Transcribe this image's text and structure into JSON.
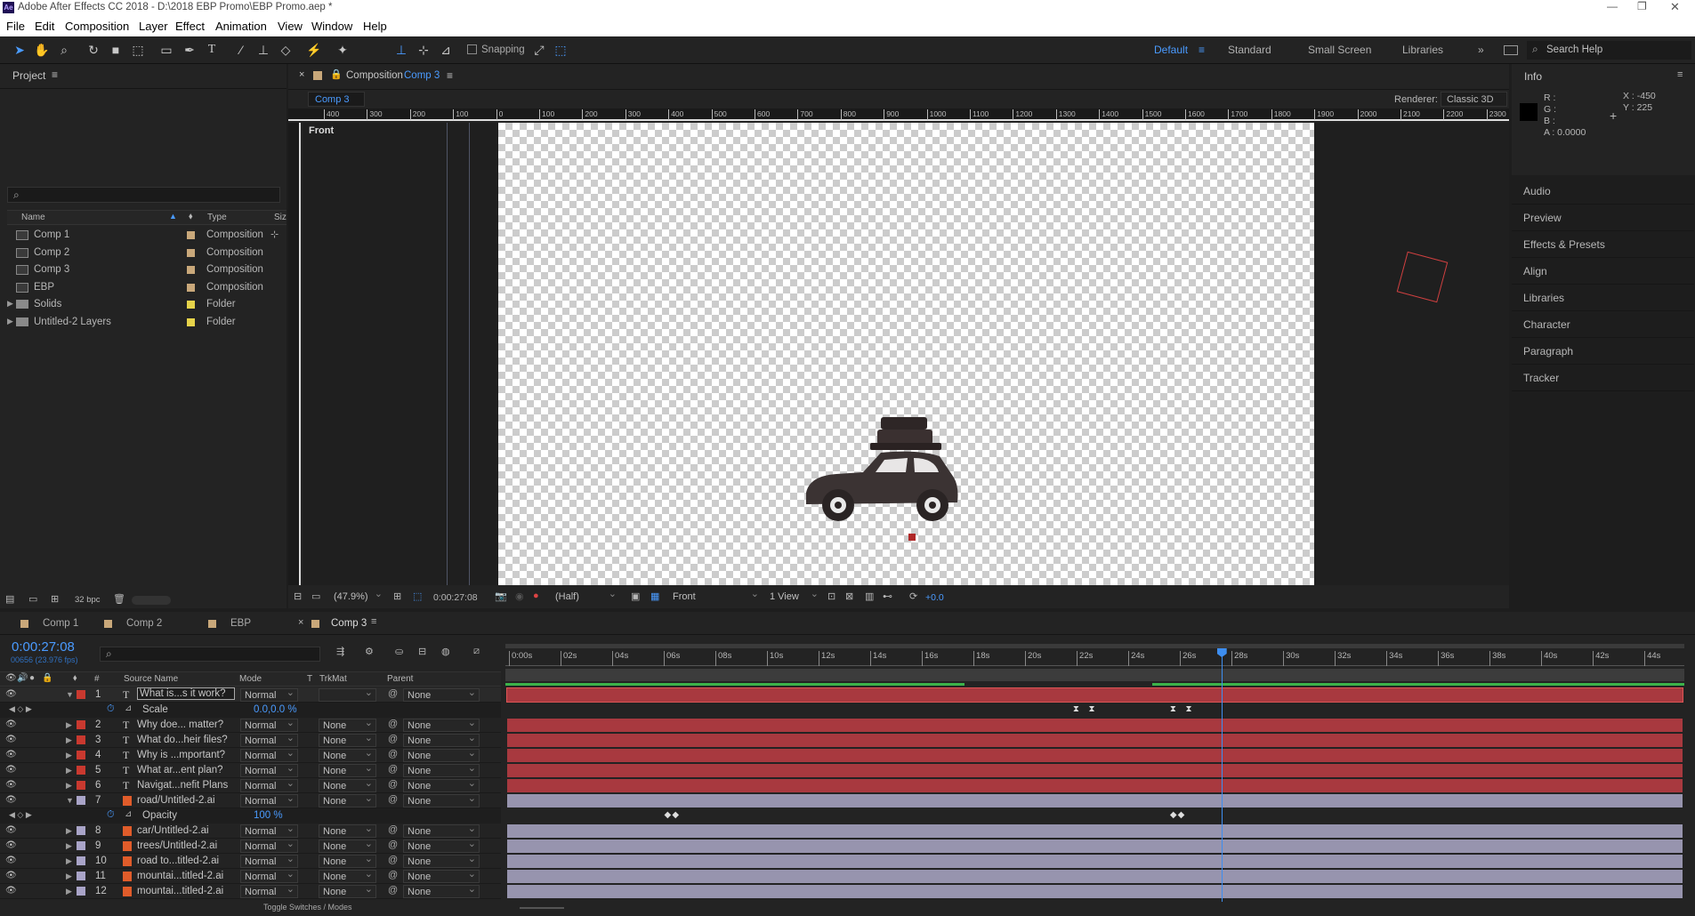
{
  "app": {
    "title": "Adobe After Effects CC 2018 - D:\\2018 EBP Promo\\EBP Promo.aep *",
    "menu": [
      "File",
      "Edit",
      "Composition",
      "Layer",
      "Effect",
      "Animation",
      "View",
      "Window",
      "Help"
    ],
    "window_controls": [
      "minimize-icon",
      "restore-icon",
      "close-icon"
    ]
  },
  "toolbar": {
    "snapping_label": "Snapping",
    "workspaces": [
      "Default",
      "Standard",
      "Small Screen",
      "Libraries"
    ],
    "active_workspace": "Default",
    "search_placeholder": "Search Help"
  },
  "project": {
    "title": "Project",
    "columns": {
      "name": "Name",
      "type": "Type",
      "size": "Siz"
    },
    "items": [
      {
        "name": "Comp 1",
        "type": "Composition",
        "color": "#c9a87a",
        "kind": "comp"
      },
      {
        "name": "Comp 2",
        "type": "Composition",
        "color": "#c9a87a",
        "kind": "comp"
      },
      {
        "name": "Comp 3",
        "type": "Composition",
        "color": "#c9a87a",
        "kind": "comp"
      },
      {
        "name": "EBP",
        "type": "Composition",
        "color": "#c9a87a",
        "kind": "comp"
      },
      {
        "name": "Solids",
        "type": "Folder",
        "color": "#e6d34a",
        "kind": "folder"
      },
      {
        "name": "Untitled-2 Layers",
        "type": "Folder",
        "color": "#e6d34a",
        "kind": "folder"
      }
    ],
    "bpc": "32 bpc"
  },
  "composition": {
    "tab_prefix": "Composition",
    "tab_name": "Comp 3",
    "subtab": "Comp 3",
    "renderer_label": "Renderer:",
    "renderer_value": "Classic 3D",
    "view_label": "Front",
    "ruler_ticks": [
      "400",
      "300",
      "200",
      "100",
      "0",
      "100",
      "200",
      "300",
      "400",
      "500",
      "600",
      "700",
      "800",
      "900",
      "1000",
      "1100",
      "1200",
      "1300",
      "1400",
      "1500",
      "1600",
      "1700",
      "1800",
      "1900",
      "2000",
      "2100",
      "2200",
      "2300"
    ],
    "footer": {
      "zoom": "(47.9%)",
      "timecode": "0:00:27:08",
      "resolution": "(Half)",
      "view": "Front",
      "views": "1 View",
      "exposure": "+0.0"
    }
  },
  "info": {
    "title": "Info",
    "r": "R :",
    "g": "G :",
    "b": "B :",
    "a": "A : 0.0000",
    "x": "X : -450",
    "y": "Y : 225"
  },
  "right_panels": [
    "Audio",
    "Preview",
    "Effects & Presets",
    "Align",
    "Libraries",
    "Character",
    "Paragraph",
    "Tracker"
  ],
  "timeline": {
    "tabs": [
      {
        "name": "Comp 1",
        "color": "#c9a87a"
      },
      {
        "name": "Comp 2",
        "color": "#c9a87a"
      },
      {
        "name": "EBP",
        "color": "#c9a87a"
      },
      {
        "name": "Comp 3",
        "color": "#c9a87a"
      }
    ],
    "active_tab": "Comp 3",
    "timecode": "0:00:27:08",
    "fps": "00656 (23.976 fps)",
    "columns": {
      "num": "#",
      "source": "Source Name",
      "mode": "Mode",
      "t": "T",
      "trkmat": "TrkMat",
      "parent": "Parent"
    },
    "time_ticks": [
      "0:00s",
      "02s",
      "04s",
      "06s",
      "08s",
      "10s",
      "12s",
      "14s",
      "16s",
      "18s",
      "20s",
      "22s",
      "24s",
      "26s",
      "28s",
      "30s",
      "32s",
      "34s",
      "36s",
      "38s",
      "40s",
      "42s",
      "44s"
    ],
    "playhead_seconds": 27.33,
    "duration_seconds": 45,
    "rows": [
      {
        "kind": "layer",
        "num": "1",
        "type": "T",
        "name": "What is...s it work?",
        "mode": "Normal",
        "trkmat": "",
        "parent": "None",
        "label": "#c9392f",
        "expanded": true,
        "bar": "red",
        "selected": true
      },
      {
        "kind": "prop",
        "name": "Scale",
        "value": "0.0,0.0 %",
        "keys": [
          21.8,
          22.4,
          25.5,
          26.1
        ]
      },
      {
        "kind": "layer",
        "num": "2",
        "type": "T",
        "name": "Why doe... matter?",
        "mode": "Normal",
        "trkmat": "None",
        "parent": "None",
        "label": "#c9392f",
        "bar": "red"
      },
      {
        "kind": "layer",
        "num": "3",
        "type": "T",
        "name": "What do...heir files?",
        "mode": "Normal",
        "trkmat": "None",
        "parent": "None",
        "label": "#c9392f",
        "bar": "red"
      },
      {
        "kind": "layer",
        "num": "4",
        "type": "T",
        "name": "Why is ...mportant?",
        "mode": "Normal",
        "trkmat": "None",
        "parent": "None",
        "label": "#c9392f",
        "bar": "red"
      },
      {
        "kind": "layer",
        "num": "5",
        "type": "T",
        "name": "What ar...ent plan?",
        "mode": "Normal",
        "trkmat": "None",
        "parent": "None",
        "label": "#c9392f",
        "bar": "red"
      },
      {
        "kind": "layer",
        "num": "6",
        "type": "T",
        "name": "Navigat...nefit Plans",
        "mode": "Normal",
        "trkmat": "None",
        "parent": "None",
        "label": "#c9392f",
        "bar": "red"
      },
      {
        "kind": "layer",
        "num": "7",
        "type": "ai",
        "name": "road/Untitled-2.ai",
        "mode": "Normal",
        "trkmat": "None",
        "parent": "None",
        "label": "#a9a4c8",
        "expanded": true,
        "bar": "lavender"
      },
      {
        "kind": "prop",
        "name": "Opacity",
        "value": "100 %",
        "keys": [
          6.2,
          6.5,
          25.5,
          25.8
        ]
      },
      {
        "kind": "layer",
        "num": "8",
        "type": "ai",
        "name": "car/Untitled-2.ai",
        "mode": "Normal",
        "trkmat": "None",
        "parent": "None",
        "label": "#a9a4c8",
        "bar": "lavender"
      },
      {
        "kind": "layer",
        "num": "9",
        "type": "ai",
        "name": "trees/Untitled-2.ai",
        "mode": "Normal",
        "trkmat": "None",
        "parent": "None",
        "label": "#a9a4c8",
        "bar": "lavender"
      },
      {
        "kind": "layer",
        "num": "10",
        "type": "ai",
        "name": "road to...titled-2.ai",
        "mode": "Normal",
        "trkmat": "None",
        "parent": "None",
        "label": "#a9a4c8",
        "bar": "lavender"
      },
      {
        "kind": "layer",
        "num": "11",
        "type": "ai",
        "name": "mountai...titled-2.ai",
        "mode": "Normal",
        "trkmat": "None",
        "parent": "None",
        "label": "#a9a4c8",
        "bar": "lavender"
      },
      {
        "kind": "layer",
        "num": "12",
        "type": "ai",
        "name": "mountai...titled-2.ai",
        "mode": "Normal",
        "trkmat": "None",
        "parent": "None",
        "label": "#a9a4c8",
        "bar": "lavender"
      }
    ],
    "toggle_label": "Toggle Switches / Modes"
  }
}
